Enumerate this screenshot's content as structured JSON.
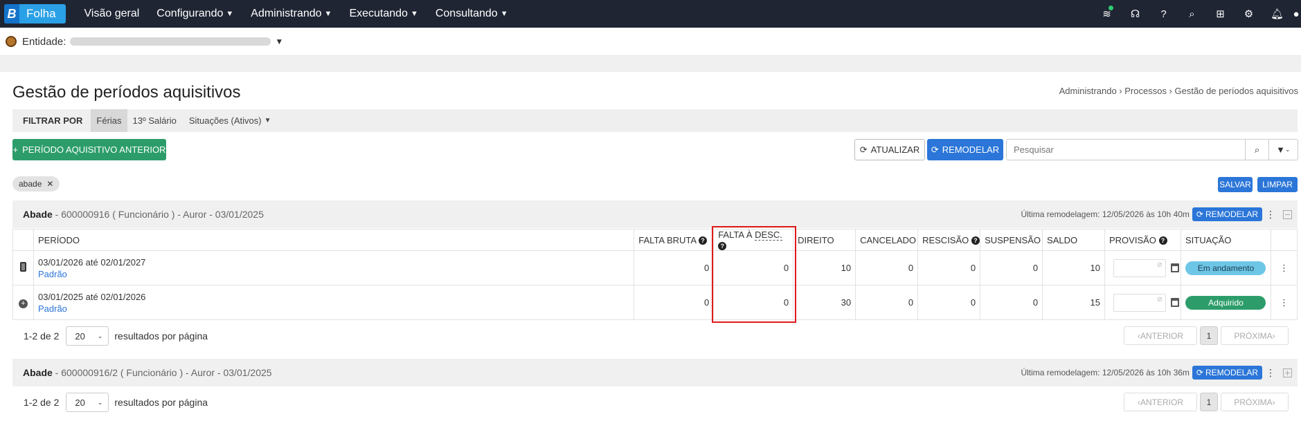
{
  "nav": {
    "brand": "Folha",
    "items": [
      "Visão geral",
      "Configurando",
      "Administrando",
      "Executando",
      "Consultando"
    ]
  },
  "entity": {
    "label": "Entidade:"
  },
  "page": {
    "title": "Gestão de períodos aquisitivos",
    "breadcrumb": "Administrando › Processos › Gestão de períodos aquisitivos"
  },
  "filter": {
    "label": "FILTRAR POR",
    "tabs": [
      "Férias",
      "13º Salário"
    ],
    "situacao": "Situações (Ativos)"
  },
  "actions": {
    "add_label": "PERÍODO AQUISITIVO ANTERIOR",
    "atualizar_label": "ATUALIZAR",
    "remodelar_label": "REMODELAR",
    "search_placeholder": "Pesquisar",
    "chip": "abade",
    "salvar": "SALVAR",
    "limpar": "LIMPAR"
  },
  "group1": {
    "name": "Abade",
    "meta": " - 600000916 ( Funcionário ) - Auror - 03/01/2025",
    "last_remod": "Última remodelagem: 12/05/2026 às 10h 40m",
    "remod_btn": "REMODELAR"
  },
  "group2": {
    "name": "Abade",
    "meta": " - 600000916/2 ( Funcionário ) - Auror - 03/01/2025",
    "last_remod": "Última remodelagem: 12/05/2026 às 10h 36m",
    "remod_btn": "REMODELAR"
  },
  "table": {
    "headers": {
      "periodo": "PERÍODO",
      "falta_bruta": "FALTA BRUTA",
      "falta_desc_1": "FALTA À ",
      "falta_desc_2": "DESC.",
      "direito": "DIREITO",
      "cancelado": "CANCELADO",
      "rescisao": "RESCISÃO",
      "suspensao": "SUSPENSÃO",
      "saldo": "SALDO",
      "provisao": "PROVISÃO",
      "situacao": "SITUAÇÃO"
    },
    "rows": [
      {
        "periodo": "03/01/2026 até 02/01/2027",
        "tipo": "Padrão",
        "falta_bruta": "0",
        "falta_desc": "0",
        "direito": "10",
        "cancelado": "0",
        "rescisao": "0",
        "suspensao": "0",
        "saldo": "10",
        "situacao": "Em andamento"
      },
      {
        "periodo": "03/01/2025 até 02/01/2026",
        "tipo": "Padrão",
        "falta_bruta": "0",
        "falta_desc": "0",
        "direito": "30",
        "cancelado": "0",
        "rescisao": "0",
        "suspensao": "0",
        "saldo": "15",
        "situacao": "Adquirido"
      }
    ]
  },
  "pager": {
    "range": "1-2 de 2",
    "per_page": "20",
    "suffix": "resultados por página",
    "prev": "ANTERIOR",
    "current": "1",
    "next": "PRÓXIMA"
  },
  "colors": {
    "nav_bg": "#1f2533",
    "green": "#2c9d6a",
    "blue": "#2b76d8",
    "highlight": "#e01919"
  }
}
